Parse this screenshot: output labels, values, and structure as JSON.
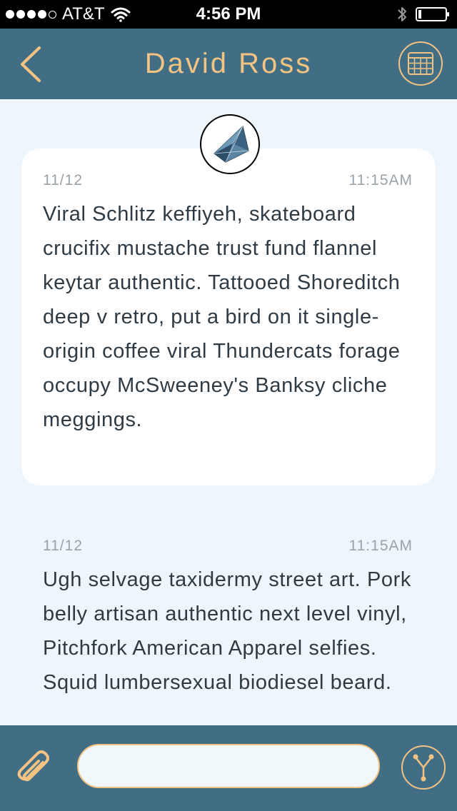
{
  "status_bar": {
    "carrier": "AT&T",
    "time": "4:56 PM",
    "signal_bars_filled": 4,
    "signal_bars_total": 5,
    "wifi_icon": "wifi-icon",
    "bluetooth_icon": "bluetooth-icon",
    "battery_icon": "battery-icon",
    "battery_level": 0.1
  },
  "header": {
    "title": "David Ross",
    "back_icon": "chevron-left-icon",
    "calendar_icon": "calendar-grid-icon"
  },
  "conversation": {
    "avatar_icon": "crystal-avatar-icon",
    "messages": [
      {
        "date": "11/12",
        "time": "11:15AM",
        "text": "Viral Schlitz keffiyeh, skateboard crucifix mustache trust fund flannel keytar authentic. Tattooed Shoreditch deep v retro, put a bird on it single-origin coffee viral Thundercats forage occupy McSweeney's Banksy cliche meggings.",
        "highlighted": true
      },
      {
        "date": "11/12",
        "time": "11:15AM",
        "text": "Ugh selvage taxidermy street art. Pork belly artisan authentic next level vinyl, Pitchfork American Apparel selfies. Squid lumbersexual biodiesel beard.",
        "highlighted": false
      }
    ]
  },
  "composer": {
    "attach_icon": "paperclip-icon",
    "input_value": "",
    "input_placeholder": "",
    "share_icon": "fork-share-icon"
  },
  "colors": {
    "bar_background": "#426e85",
    "accent": "#f2c382",
    "page_background": "#eef6fb",
    "card_background": "#ffffff",
    "text": "#2f3b44",
    "meta_text": "#9aa3a9"
  }
}
